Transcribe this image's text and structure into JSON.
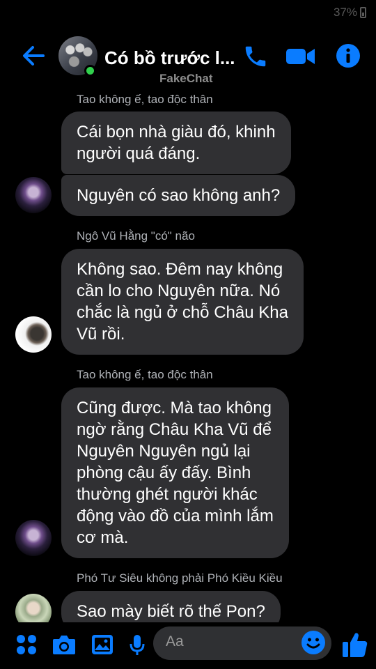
{
  "status": {
    "battery": "37%"
  },
  "header": {
    "title": "Có bồ trước l...",
    "subtitle": "FakeChat",
    "accent": "#0a7cff"
  },
  "messages": [
    {
      "sender": "Tao không ế, tao độc thân",
      "lines": [
        "Cái bọn nhà giàu đó, khinh",
        "người quá đáng."
      ]
    },
    {
      "lines": [
        "Nguyên có sao không anh?"
      ]
    },
    {
      "sender": "Ngô Vũ Hằng \"có\" não",
      "lines": [
        "Không sao. Đêm nay không",
        "cần lo cho Nguyên nữa. Nó",
        "chắc là ngủ ở chỗ Châu Kha",
        "Vũ rồi."
      ]
    },
    {
      "sender": "Tao không ế, tao độc thân",
      "lines": [
        "Cũng được. Mà tao không",
        "ngờ rằng Châu Kha Vũ để",
        "Nguyên Nguyên ngủ lại",
        "phòng cậu ấy đấy. Bình",
        "thường ghét người khác",
        "động vào đồ của mình lắm",
        "cơ mà."
      ]
    },
    {
      "sender": "Phó Tư Siêu không phải Phó Kiều Kiều",
      "lines": [
        "Sao mày biết rõ thế Pon?"
      ]
    }
  ],
  "composer": {
    "placeholder": "Aa",
    "icons": [
      "apps-icon",
      "camera-icon",
      "gallery-icon",
      "microphone-icon",
      "emoji-icon",
      "thumbs-up-icon"
    ]
  }
}
